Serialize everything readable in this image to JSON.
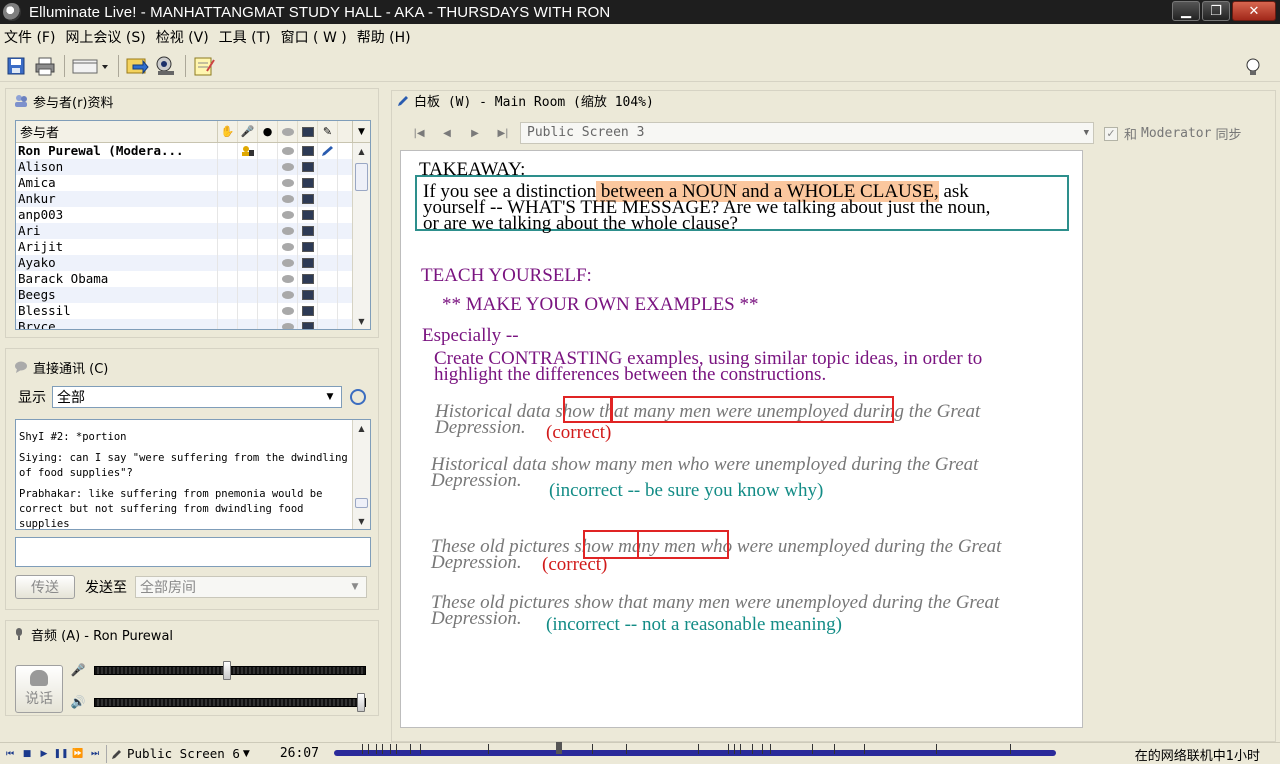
{
  "window": {
    "title": "Elluminate Live! - MANHATTANGMAT STUDY HALL - AKA - THURSDAYS WITH RON"
  },
  "menu": [
    "文件 (F)",
    "网上会议 (S)",
    "检视 (V)",
    "工具 (T)",
    "窗口 ( W )",
    "帮助 (H)"
  ],
  "participants": {
    "title": "参与者(r)资料",
    "header": "参与者",
    "rows": [
      {
        "name": "Ron Purewal (Modera...",
        "moderator": true
      },
      {
        "name": "Alison"
      },
      {
        "name": "Amica"
      },
      {
        "name": "Ankur"
      },
      {
        "name": "anp003"
      },
      {
        "name": "Ari"
      },
      {
        "name": "Arijit"
      },
      {
        "name": "Ayako"
      },
      {
        "name": "Barack Obama"
      },
      {
        "name": "Beegs"
      },
      {
        "name": "Blessil"
      },
      {
        "name": "Bryce"
      }
    ]
  },
  "chat": {
    "title": "直接通讯 (C)",
    "show_label": "显示",
    "show_value": "全部",
    "messages": [
      "ShyI #2: *portion",
      "Siying: can I say \"were suffering from the dwindling of food supplies\"?",
      "Prabhakar: like suffering from pnemonia would be correct but not suffering from dwindling food supplies"
    ],
    "send_label": "传送",
    "send_to_label": "发送至",
    "send_to_value": "全部房间"
  },
  "audio": {
    "title": "音频 (A) - Ron Purewal",
    "talk_label": "说话",
    "mic_level": 0.49,
    "speaker_level": 1.0
  },
  "whiteboard": {
    "title": "白板 (W) - Main Room (缩放 104%)",
    "screen": "Public Screen 3",
    "sync_prefix": "和",
    "sync_mod": "Moderator",
    "sync_suffix": "同步",
    "content": {
      "takeaway": "TAKEAWAY:",
      "tk1_a": "If you see a distinction",
      "tk1_hl": " between a NOUN and a WHOLE CLAUSE,",
      "tk1_b": " ask",
      "tk2": "yourself -- WHAT'S THE MESSAGE?  Are we talking about just the noun,",
      "tk3": "or are we talking about the whole clause?",
      "teach": "TEACH YOURSELF:",
      "make": "** MAKE YOUR OWN EXAMPLES **",
      "especially": "Especially --",
      "create1": "Create CONTRASTING examples, using similar topic ideas, in order to",
      "create2": "highlight the differences between the constructions.",
      "ex1a": "Historical data show that many men were unemployed during the Great",
      "ex1b": "Depression.",
      "ex1_verdict": "(correct)",
      "ex2a": "Historical data show many men who were unemployed during the Great",
      "ex2b": "Depression.",
      "ex2_verdict": "(incorrect -- be sure you know why)",
      "ex3a": "These old pictures show many men who were unemployed during the Great",
      "ex3b": "Depression.",
      "ex3_verdict": "(correct)",
      "ex4a": "These old pictures show that many men were unemployed during the Great",
      "ex4b": "Depression.",
      "ex4_verdict": "(incorrect -- not a reasonable meaning)"
    }
  },
  "status": {
    "screen": "Public Screen 6",
    "time": "26:07",
    "network": "在的网络联机中1小时"
  }
}
